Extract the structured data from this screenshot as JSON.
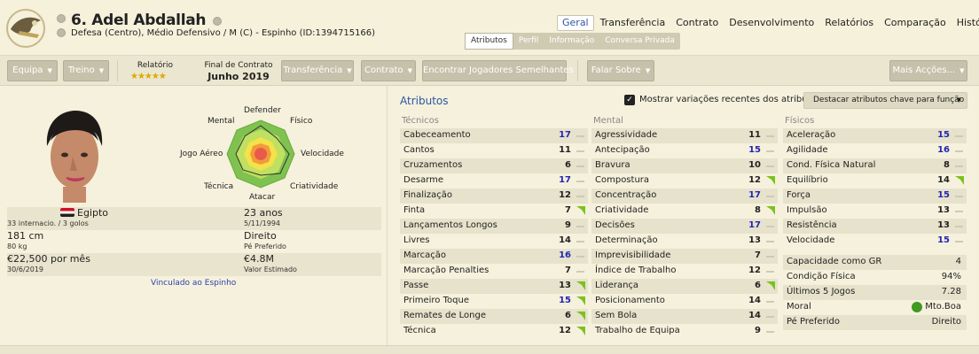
{
  "player": {
    "name": "6. Adel Abdallah",
    "subtitle": "Defesa (Centro), Médio Defensivo / M (C) - Espinho (ID:1394715166)"
  },
  "nav_main": [
    "Geral",
    "Transferência",
    "Contrato",
    "Desenvolvimento",
    "Relatórios",
    "Comparação",
    "Histórico"
  ],
  "nav_sub": [
    "Atributos",
    "Perfil",
    "Informação",
    "Conversa Privada"
  ],
  "toolbar": {
    "equipa": "Equipa",
    "treino": "Treino",
    "relatorio_label": "Relatório",
    "stars": "★★★★★",
    "contract_end_label": "Final de Contrato",
    "contract_end_value": "Junho 2019",
    "transferencia": "Transferência",
    "contrato": "Contrato",
    "encontrar": "Encontrar Jogadores Semelhantes",
    "falar": "Falar Sobre",
    "mais": "Mais Acções...",
    "caret": "▼"
  },
  "radar": {
    "labels": {
      "defender": "Defender",
      "mental": "Mental",
      "fisico": "Físico",
      "jogo_aereo": "Jogo Aéreo",
      "velocidade": "Velocidade",
      "tecnica": "Técnica",
      "criatividade": "Criatividade",
      "atacar": "Atacar"
    }
  },
  "info": {
    "nation": "Egipto",
    "caps": "33 internacio. / 3 golos",
    "age": "23 anos",
    "dob": "5/11/1994",
    "height": "181 cm",
    "weight": "80 kg",
    "foot": "Direito",
    "foot_label": "Pé Preferido",
    "wage": "€22,500 por mês",
    "wage_date": "30/6/2019",
    "value": "€4.8M",
    "value_label": "Valor Estimado",
    "contract_link": "Vinculado ao Espinho"
  },
  "attributes_panel": {
    "title": "Atributos",
    "checkbox_label": "Mostrar variações recentes dos atributos",
    "check_mark": "✓",
    "highlight_button": "Destacar atributos chave para função",
    "highlight_caret": "▼"
  },
  "technical": {
    "header": "Técnicos",
    "items": [
      {
        "name": "Cabeceamento",
        "value": 17,
        "trend": "flat"
      },
      {
        "name": "Cantos",
        "value": 11,
        "trend": "flat"
      },
      {
        "name": "Cruzamentos",
        "value": 6,
        "trend": "flat"
      },
      {
        "name": "Desarme",
        "value": 17,
        "trend": "flat"
      },
      {
        "name": "Finalização",
        "value": 12,
        "trend": "flat"
      },
      {
        "name": "Finta",
        "value": 7,
        "trend": "up"
      },
      {
        "name": "Lançamentos Longos",
        "value": 9,
        "trend": "flat"
      },
      {
        "name": "Livres",
        "value": 14,
        "trend": "flat"
      },
      {
        "name": "Marcação",
        "value": 16,
        "trend": "flat"
      },
      {
        "name": "Marcação Penalties",
        "value": 7,
        "trend": "flat"
      },
      {
        "name": "Passe",
        "value": 13,
        "trend": "up"
      },
      {
        "name": "Primeiro Toque",
        "value": 15,
        "trend": "up"
      },
      {
        "name": "Remates de Longe",
        "value": 6,
        "trend": "up"
      },
      {
        "name": "Técnica",
        "value": 12,
        "trend": "up"
      }
    ]
  },
  "mental": {
    "header": "Mental",
    "items": [
      {
        "name": "Agressividade",
        "value": 11,
        "trend": "flat"
      },
      {
        "name": "Antecipação",
        "value": 15,
        "trend": "flat"
      },
      {
        "name": "Bravura",
        "value": 10,
        "trend": "flat"
      },
      {
        "name": "Compostura",
        "value": 12,
        "trend": "up"
      },
      {
        "name": "Concentração",
        "value": 17,
        "trend": "flat"
      },
      {
        "name": "Criatividade",
        "value": 8,
        "trend": "up"
      },
      {
        "name": "Decisões",
        "value": 17,
        "trend": "flat"
      },
      {
        "name": "Determinação",
        "value": 13,
        "trend": "flat"
      },
      {
        "name": "Imprevisibilidade",
        "value": 7,
        "trend": "flat"
      },
      {
        "name": "Índice de Trabalho",
        "value": 12,
        "trend": "flat"
      },
      {
        "name": "Liderança",
        "value": 6,
        "trend": "up"
      },
      {
        "name": "Posicionamento",
        "value": 14,
        "trend": "flat"
      },
      {
        "name": "Sem Bola",
        "value": 14,
        "trend": "flat"
      },
      {
        "name": "Trabalho de Equipa",
        "value": 9,
        "trend": "flat"
      }
    ]
  },
  "physical": {
    "header": "Físicos",
    "items": [
      {
        "name": "Aceleração",
        "value": 15,
        "trend": "flat"
      },
      {
        "name": "Agilidade",
        "value": 16,
        "trend": "flat"
      },
      {
        "name": "Cond. Física Natural",
        "value": 8,
        "trend": "flat"
      },
      {
        "name": "Equilíbrio",
        "value": 14,
        "trend": "up"
      },
      {
        "name": "Força",
        "value": 15,
        "trend": "flat"
      },
      {
        "name": "Impulsão",
        "value": 13,
        "trend": "flat"
      },
      {
        "name": "Resistência",
        "value": 13,
        "trend": "flat"
      },
      {
        "name": "Velocidade",
        "value": 15,
        "trend": "flat"
      }
    ]
  },
  "stats": [
    {
      "name": "Capacidade como GR",
      "value": "4"
    },
    {
      "name": "Condição Física",
      "value": "94%"
    },
    {
      "name": "Últimos 5 Jogos",
      "value": "7.28"
    },
    {
      "name": "Moral",
      "value": "Mto.Boa"
    },
    {
      "name": "Pé Preferido",
      "value": "Direito"
    }
  ],
  "colors": {
    "accent_blue": "#2f55a4",
    "high_value": "#2424b5",
    "trend_up": "#7cc11d",
    "moral_green": "#3f9a1f"
  }
}
